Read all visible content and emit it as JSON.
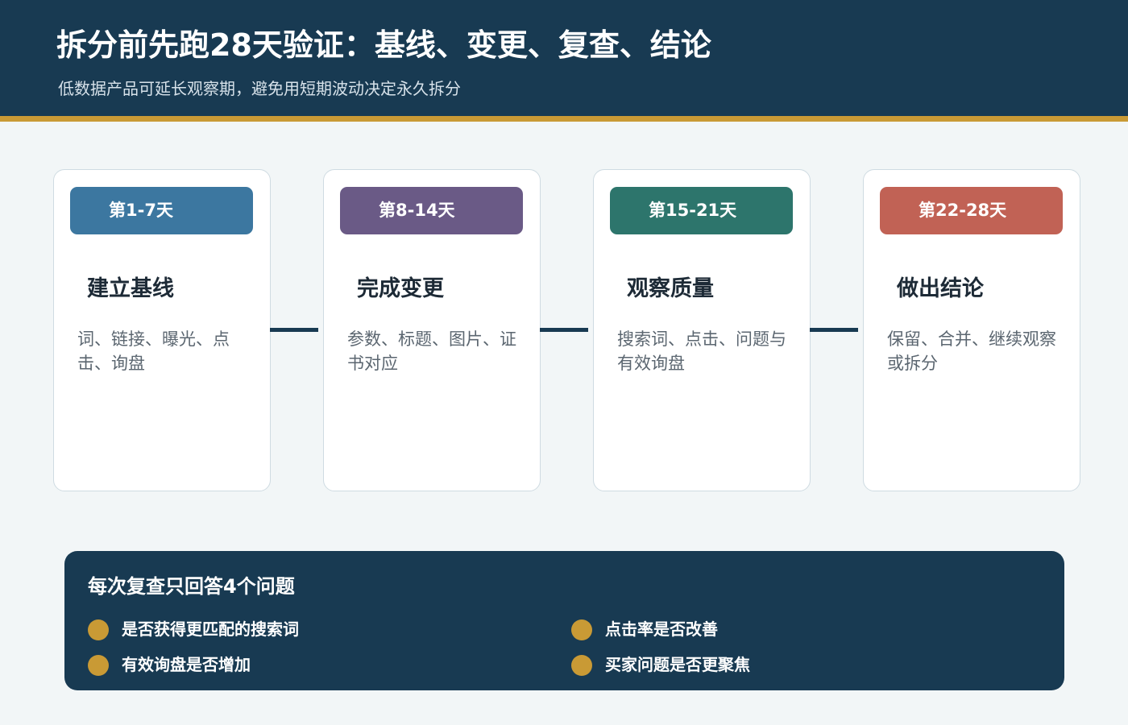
{
  "header": {
    "title": "拆分前先跑28天验证：基线、变更、复查、结论",
    "subtitle": "低数据产品可延长观察期，避免用短期波动决定永久拆分"
  },
  "stages": [
    {
      "badge": "第1-7天",
      "name": "建立基线",
      "description": "词、链接、曝光、点击、询盘",
      "color": "#3c77a0"
    },
    {
      "badge": "第8-14天",
      "name": "完成变更",
      "description": "参数、标题、图片、证书对应",
      "color": "#6a5a86"
    },
    {
      "badge": "第15-21天",
      "name": "观察质量",
      "description": "搜索词、点击、问题与有效询盘",
      "color": "#2d756c"
    },
    {
      "badge": "第22-28天",
      "name": "做出结论",
      "description": "保留、合并、继续观察或拆分",
      "color": "#c16255"
    }
  ],
  "review": {
    "title": "每次复查只回答4个问题",
    "questions": [
      "是否获得更匹配的搜索词",
      "点击率是否改善",
      "有效询盘是否增加",
      "买家问题是否更聚焦"
    ]
  },
  "colors": {
    "header_bg": "#183a52",
    "accent": "#c99a35",
    "page_bg": "#f2f6f7"
  }
}
